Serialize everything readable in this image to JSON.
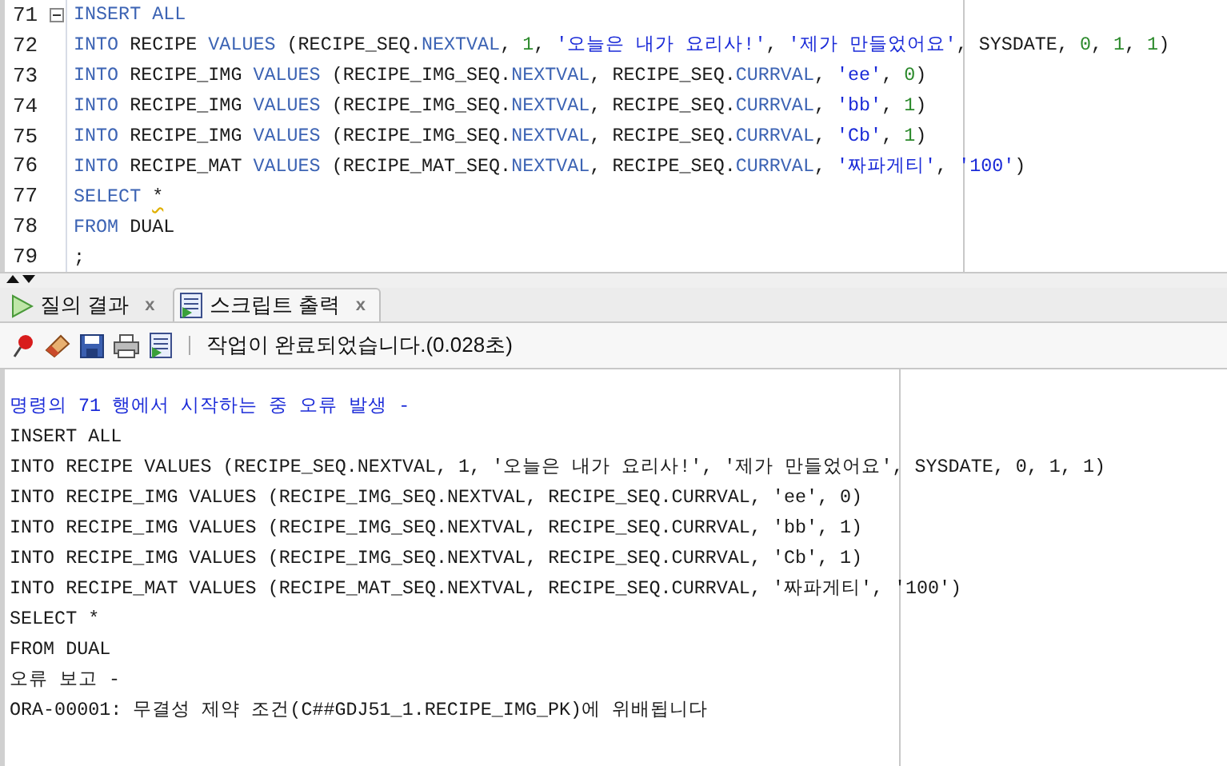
{
  "editor": {
    "lines": [
      {
        "number": "71",
        "fold": true,
        "tokens": [
          {
            "text": "INSERT ALL",
            "kind": "keyword"
          }
        ]
      },
      {
        "number": "72",
        "fold": false,
        "tokens": [
          {
            "text": "INTO",
            "kind": "keyword"
          },
          {
            "text": " RECIPE ",
            "kind": "plain"
          },
          {
            "text": "VALUES",
            "kind": "keyword"
          },
          {
            "text": " (RECIPE_SEQ.",
            "kind": "plain"
          },
          {
            "text": "NEXTVAL",
            "kind": "keyword"
          },
          {
            "text": ", ",
            "kind": "plain"
          },
          {
            "text": "1",
            "kind": "number"
          },
          {
            "text": ", ",
            "kind": "plain"
          },
          {
            "text": "'오늘은 내가 요리사!'",
            "kind": "string"
          },
          {
            "text": ", ",
            "kind": "plain"
          },
          {
            "text": "'제가 만들었어요'",
            "kind": "string"
          },
          {
            "text": ", SYSDATE, ",
            "kind": "plain"
          },
          {
            "text": "0",
            "kind": "number"
          },
          {
            "text": ", ",
            "kind": "plain"
          },
          {
            "text": "1",
            "kind": "number"
          },
          {
            "text": ", ",
            "kind": "plain"
          },
          {
            "text": "1",
            "kind": "number"
          },
          {
            "text": ")",
            "kind": "plain"
          }
        ]
      },
      {
        "number": "73",
        "fold": false,
        "tokens": [
          {
            "text": "INTO",
            "kind": "keyword"
          },
          {
            "text": " RECIPE_IMG ",
            "kind": "plain"
          },
          {
            "text": "VALUES",
            "kind": "keyword"
          },
          {
            "text": " (RECIPE_IMG_SEQ.",
            "kind": "plain"
          },
          {
            "text": "NEXTVAL",
            "kind": "keyword"
          },
          {
            "text": ", RECIPE_SEQ.",
            "kind": "plain"
          },
          {
            "text": "CURRVAL",
            "kind": "keyword"
          },
          {
            "text": ", ",
            "kind": "plain"
          },
          {
            "text": "'ee'",
            "kind": "string"
          },
          {
            "text": ", ",
            "kind": "plain"
          },
          {
            "text": "0",
            "kind": "number"
          },
          {
            "text": ")",
            "kind": "plain"
          }
        ]
      },
      {
        "number": "74",
        "fold": false,
        "tokens": [
          {
            "text": "INTO",
            "kind": "keyword"
          },
          {
            "text": " RECIPE_IMG ",
            "kind": "plain"
          },
          {
            "text": "VALUES",
            "kind": "keyword"
          },
          {
            "text": " (RECIPE_IMG_SEQ.",
            "kind": "plain"
          },
          {
            "text": "NEXTVAL",
            "kind": "keyword"
          },
          {
            "text": ", RECIPE_SEQ.",
            "kind": "plain"
          },
          {
            "text": "CURRVAL",
            "kind": "keyword"
          },
          {
            "text": ", ",
            "kind": "plain"
          },
          {
            "text": "'bb'",
            "kind": "string"
          },
          {
            "text": ", ",
            "kind": "plain"
          },
          {
            "text": "1",
            "kind": "number"
          },
          {
            "text": ")",
            "kind": "plain"
          }
        ]
      },
      {
        "number": "75",
        "fold": false,
        "tokens": [
          {
            "text": "INTO",
            "kind": "keyword"
          },
          {
            "text": " RECIPE_IMG ",
            "kind": "plain"
          },
          {
            "text": "VALUES",
            "kind": "keyword"
          },
          {
            "text": " (RECIPE_IMG_SEQ.",
            "kind": "plain"
          },
          {
            "text": "NEXTVAL",
            "kind": "keyword"
          },
          {
            "text": ", RECIPE_SEQ.",
            "kind": "plain"
          },
          {
            "text": "CURRVAL",
            "kind": "keyword"
          },
          {
            "text": ", ",
            "kind": "plain"
          },
          {
            "text": "'Cb'",
            "kind": "string"
          },
          {
            "text": ", ",
            "kind": "plain"
          },
          {
            "text": "1",
            "kind": "number"
          },
          {
            "text": ")",
            "kind": "plain"
          }
        ]
      },
      {
        "number": "76",
        "fold": false,
        "tokens": [
          {
            "text": "INTO",
            "kind": "keyword"
          },
          {
            "text": " RECIPE_MAT ",
            "kind": "plain"
          },
          {
            "text": "VALUES",
            "kind": "keyword"
          },
          {
            "text": " (RECIPE_MAT_SEQ.",
            "kind": "plain"
          },
          {
            "text": "NEXTVAL",
            "kind": "keyword"
          },
          {
            "text": ", RECIPE_SEQ.",
            "kind": "plain"
          },
          {
            "text": "CURRVAL",
            "kind": "keyword"
          },
          {
            "text": ", ",
            "kind": "plain"
          },
          {
            "text": "'짜파게티'",
            "kind": "string"
          },
          {
            "text": ", ",
            "kind": "plain"
          },
          {
            "text": "'100'",
            "kind": "string"
          },
          {
            "text": ")",
            "kind": "plain"
          }
        ]
      },
      {
        "number": "77",
        "fold": false,
        "tokens": [
          {
            "text": "SELECT ",
            "kind": "keyword"
          },
          {
            "text": "*",
            "kind": "warning"
          }
        ]
      },
      {
        "number": "78",
        "fold": false,
        "tokens": [
          {
            "text": "FROM",
            "kind": "keyword"
          },
          {
            "text": " DUAL",
            "kind": "plain"
          }
        ]
      },
      {
        "number": "79",
        "fold": false,
        "tokens": [
          {
            "text": ";",
            "kind": "plain"
          }
        ]
      }
    ]
  },
  "tabs": [
    {
      "label": "질의 결과",
      "close": "x",
      "kind": "query",
      "selected": false
    },
    {
      "label": "스크립트 출력",
      "close": "x",
      "kind": "script",
      "selected": true
    }
  ],
  "toolbar": {
    "status": "작업이 완료되었습니다.(0.028초)"
  },
  "output": [
    {
      "text": "명령의 71 행에서 시작하는 중 오류 발생 -",
      "kind": "message"
    },
    {
      "text": "INSERT ALL",
      "kind": "code"
    },
    {
      "text": "INTO RECIPE VALUES (RECIPE_SEQ.NEXTVAL, 1, '오늘은 내가 요리사!', '제가 만들었어요', SYSDATE, 0, 1, 1)",
      "kind": "code"
    },
    {
      "text": "INTO RECIPE_IMG VALUES (RECIPE_IMG_SEQ.NEXTVAL, RECIPE_SEQ.CURRVAL, 'ee', 0)",
      "kind": "code"
    },
    {
      "text": "INTO RECIPE_IMG VALUES (RECIPE_IMG_SEQ.NEXTVAL, RECIPE_SEQ.CURRVAL, 'bb', 1)",
      "kind": "code"
    },
    {
      "text": "INTO RECIPE_IMG VALUES (RECIPE_IMG_SEQ.NEXTVAL, RECIPE_SEQ.CURRVAL, 'Cb', 1)",
      "kind": "code"
    },
    {
      "text": "INTO RECIPE_MAT VALUES (RECIPE_MAT_SEQ.NEXTVAL, RECIPE_SEQ.CURRVAL, '짜파게티', '100')",
      "kind": "code"
    },
    {
      "text": "SELECT *",
      "kind": "code"
    },
    {
      "text": "FROM DUAL",
      "kind": "code"
    },
    {
      "text": "오류 보고 -",
      "kind": "code"
    },
    {
      "text": "ORA-00001: 무결성 제약 조건(C##GDJ51_1.RECIPE_IMG_PK)에 위배됩니다",
      "kind": "code"
    }
  ]
}
